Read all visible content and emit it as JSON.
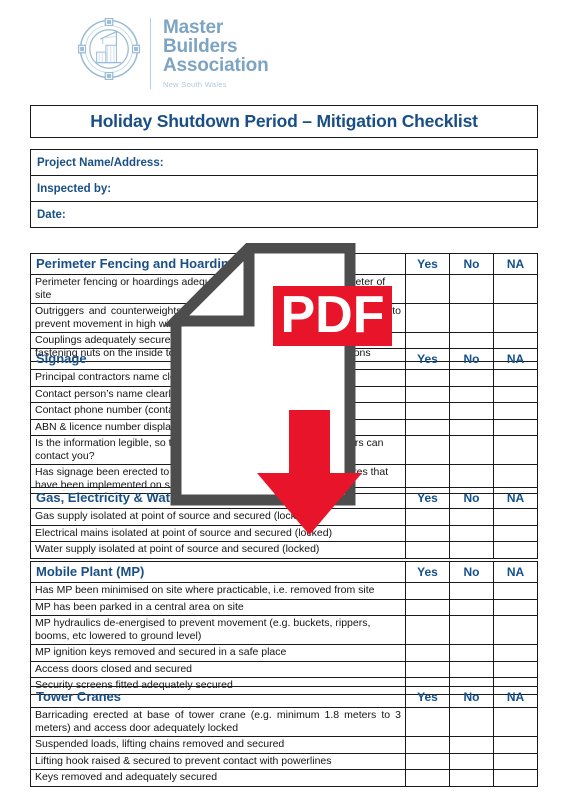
{
  "brand": {
    "logo_icon": "master-builders-crane-emblem",
    "name_lines": [
      "Master",
      "Builders",
      "Association"
    ],
    "subtitle": "New South Wales",
    "logo_color": "#7ea4c4",
    "subtitle_color": "#b3c8da"
  },
  "document": {
    "title": "Holiday Shutdown Period – Mitigation Checklist",
    "title_color": "#1a4f86"
  },
  "info_fields": [
    {
      "label": "Project Name/Address:",
      "value": ""
    },
    {
      "label": "Inspected by:",
      "value": ""
    },
    {
      "label": "Date:",
      "value": ""
    }
  ],
  "columns": {
    "yes": "Yes",
    "no": "No",
    "na": "NA"
  },
  "sections": [
    {
      "heading": "Perimeter Fencing and Hoarding",
      "items": [
        "Perimeter fencing or hoardings adequately secured around the perimeter of site",
        "Outriggers and counterweights adequately secured and fixed to hoarding to prevent movement in high winds",
        "Couplings adequately secured with fastening nuts facing inwards and fastening nuts on the inside to prevent removal by unauthorised persons"
      ]
    },
    {
      "heading": "Signage",
      "items": [
        "Principal contractors name clearly displayed",
        "Contact person’s name clearly displayed",
        "Contact phone number  (contactable 24 hours) displayed",
        "ABN & licence number displayed",
        "Is the information legible, so that in the event of an incident neighbours can contact you?",
        "Has signage been erected to advise the public of the security measures that have been implemented on site"
      ]
    },
    {
      "heading": "Gas, Electricity & Water",
      "items": [
        "Gas supply isolated at point of source and secured (locked)",
        "Electrical mains isolated at point of source and secured (locked)",
        "Water supply isolated at point of source and secured (locked)"
      ]
    },
    {
      "heading": "Mobile Plant (MP)",
      "items": [
        "Has MP been minimised on site where practicable, i.e. removed from site",
        "MP has been parked in a central area on site",
        "MP hydraulics de-energised to prevent movement (e.g. buckets, rippers, booms, etc lowered to ground level)",
        "MP ignition keys removed and secured in a safe place",
        "Access doors closed and secured",
        "Security screens fitted adequately secured"
      ]
    },
    {
      "heading": "Tower Cranes",
      "items": [
        "Barricading erected at base of tower crane (e.g. minimum 1.8 meters to 3 meters) and access door adequately locked",
        "Suspended loads, lifting chains removed and secured",
        "Lifting hook raised & secured to prevent contact with powerlines",
        "Keys removed and adequately secured"
      ]
    }
  ],
  "watermark": {
    "icon": "pdf-document-download-icon",
    "label": "PDF",
    "page_outline_color": "#4d4d4d",
    "accent_color": "#e8152a"
  }
}
